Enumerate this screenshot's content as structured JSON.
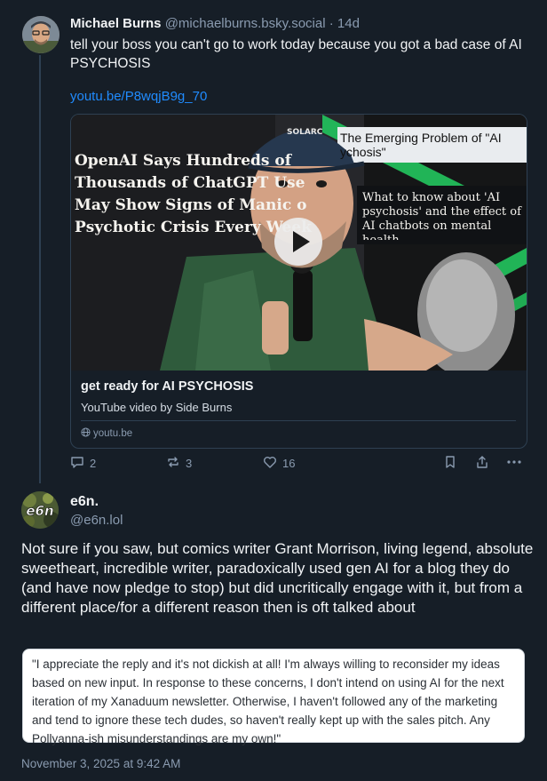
{
  "post1": {
    "author_name": "Michael Burns",
    "author_handle": "@michaelburns.bsky.social",
    "separator": "·",
    "age": "14d",
    "text": "tell your boss you can't go to work today because you got a bad case of AI PSYCHOSIS",
    "link": "youtu.be/P8wqjB9g_70",
    "embed": {
      "headline_left": [
        "OpenAI Says Hundreds of",
        "Thousands of ChatGPT Use",
        "May Show Signs of Manic o",
        "Psychotic Crisis Every Week"
      ],
      "headline_right_top": [
        "The Emerging Problem of \"AI",
        "ychosis\""
      ],
      "headline_right_mid": [
        "What to know about 'AI",
        "psychosis' and the effect of",
        "AI chatbots on mental",
        "health"
      ],
      "cap_text": "SOLARC",
      "title": "get ready for AI PSYCHOSIS",
      "description": "YouTube video by Side Burns",
      "domain": "youtu.be"
    },
    "actions": {
      "replies": "2",
      "reposts": "3",
      "likes": "16"
    }
  },
  "post2": {
    "author_name": "e6n.",
    "author_handle": "@e6n.lol",
    "avatar_text": "e6n",
    "text": "Not sure if you saw, but comics writer Grant Morrison, living legend, absolute sweetheart, incredible writer, paradoxically used gen AI for a blog they do (and have now pledge to stop) but did uncritically engage with it, but from a different place/for a different reason then is oft talked about",
    "quote": "\"I appreciate the reply and it's not dickish at all! I'm always willing to reconsider my ideas based on new input. In response to these concerns, I don't intend on using AI for the next iteration of my Xanaduum newsletter. Otherwise, I haven't followed any of the marketing and tend to ignore these tech dudes, so haven't really kept up with the sales pitch. Any Pollyanna-ish misunderstandings are my own!\"",
    "timestamp": "November 3, 2025 at 9:42 AM"
  },
  "colors": {
    "background": "#161e27",
    "link": "#208bfe",
    "muted": "#8a9bb0",
    "accent_green": "#22c55e"
  },
  "icons": [
    "reply-icon",
    "repost-icon",
    "like-icon",
    "bookmark-icon",
    "share-icon",
    "more-icon",
    "globe-icon",
    "play-icon"
  ]
}
